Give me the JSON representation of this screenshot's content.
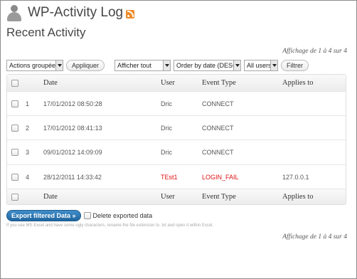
{
  "header": {
    "app_title": "WP-Activity Log",
    "user_icon": "user-avatar-icon",
    "rss_icon": "rss-feed-icon",
    "rss_color": "#f18a27"
  },
  "page_title": "Recent Activity",
  "pager": {
    "top": "Affichage de 1 à 4 sur 4",
    "bottom": "Affichage de 1 à 4 sur 4"
  },
  "toolbar": {
    "bulk_actions": "Actions groupées",
    "apply_label": "Appliquer",
    "show_filter": "Afficher tout",
    "order_filter": "Order by date (DESC)",
    "users_filter": "All users",
    "filter_button": "Filtrer"
  },
  "table": {
    "columns": [
      "Date",
      "User",
      "Event Type",
      "Applies to"
    ],
    "rows": [
      {
        "num": "1",
        "date": "17/01/2012 08:50:28",
        "user": "Dric",
        "event": "CONNECT",
        "applies": ""
      },
      {
        "num": "2",
        "date": "17/01/2012 08:41:13",
        "user": "Dric",
        "event": "CONNECT",
        "applies": ""
      },
      {
        "num": "3",
        "date": "09/01/2012 14:09:09",
        "user": "Dric",
        "event": "CONNECT",
        "applies": ""
      },
      {
        "num": "4",
        "date": "28/12/2011 14:33:42",
        "user": "TEst1",
        "event": "LOGIN_FAIL",
        "applies": "127.0.0.1"
      }
    ],
    "fail_color": "#e21111"
  },
  "export": {
    "button_label": "Export filtered Data »",
    "delete_label": "Delete exported data",
    "button_color": "#21669f"
  },
  "hint": "If you use MS Excel and have some ugly characters, rename the file extension to .txt and open it within Excel."
}
